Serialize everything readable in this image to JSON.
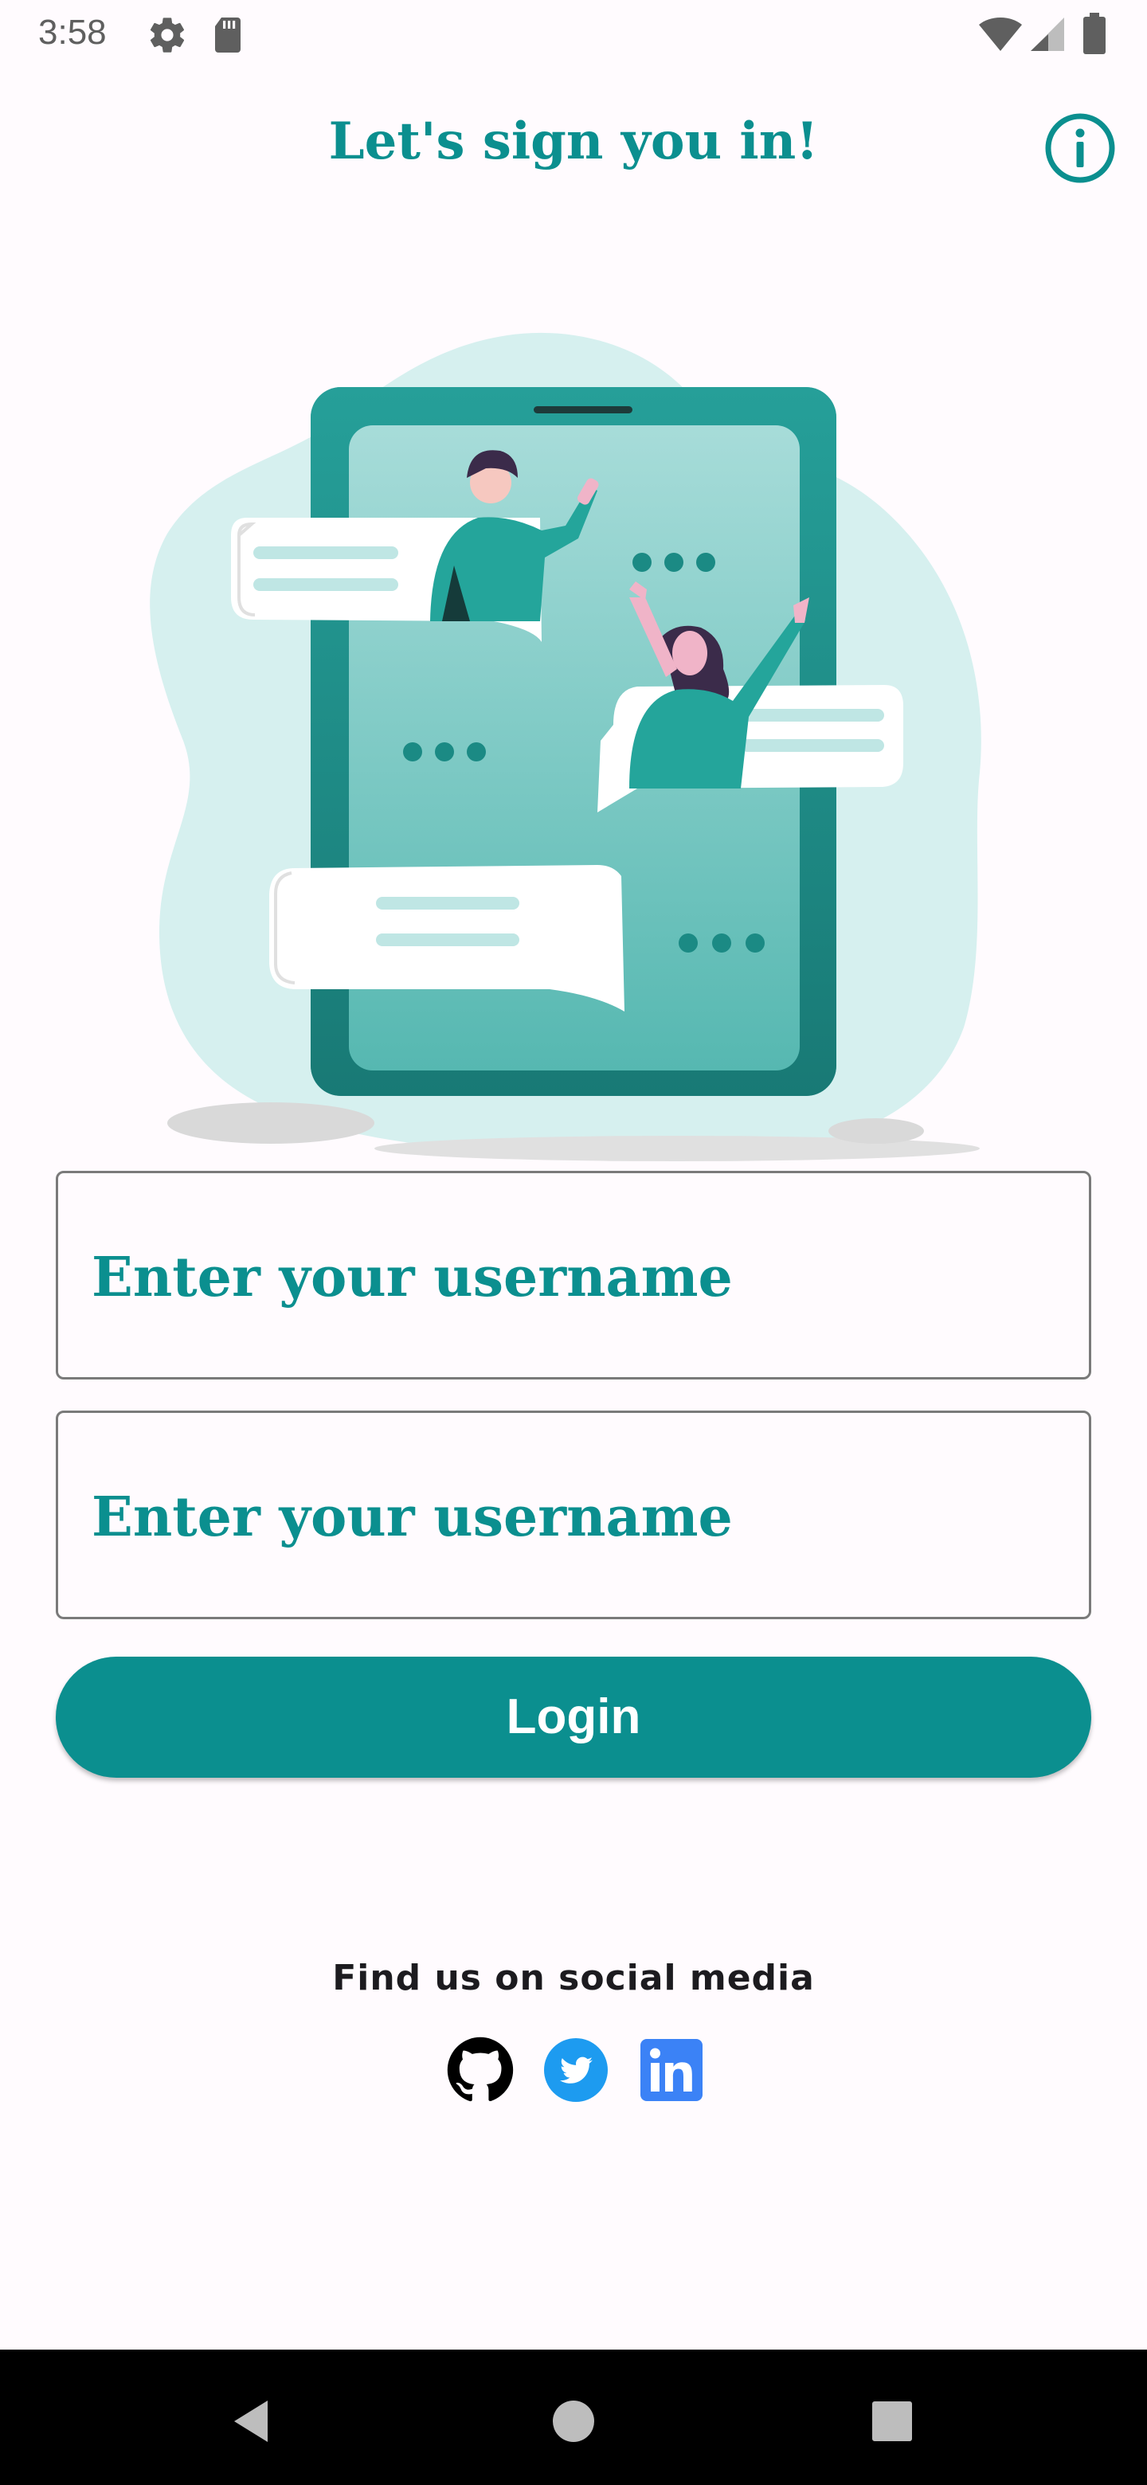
{
  "status_bar": {
    "time": "3:58",
    "icons": [
      "gear-icon",
      "sd-card-icon",
      "wifi-icon",
      "signal-icon",
      "battery-icon"
    ]
  },
  "header": {
    "title": "Let's sign you in!",
    "info_icon": "info-icon"
  },
  "illustration": {
    "name": "chat-illustration"
  },
  "form": {
    "username_placeholder": "Enter your username",
    "password_placeholder": "Enter your username",
    "login_label": "Login"
  },
  "social": {
    "heading": "Find us on social media",
    "links": [
      {
        "icon": "github-icon"
      },
      {
        "icon": "twitter-icon"
      },
      {
        "icon": "linkedin-icon"
      }
    ]
  },
  "nav": {
    "buttons": [
      "back-icon",
      "home-icon",
      "recents-icon"
    ]
  },
  "colors": {
    "accent": "#0b8f8f",
    "background": "#fffbfe",
    "text": "#1c1b1f",
    "twitter": "#1d9bf0",
    "linkedin": "#3b82f6"
  }
}
